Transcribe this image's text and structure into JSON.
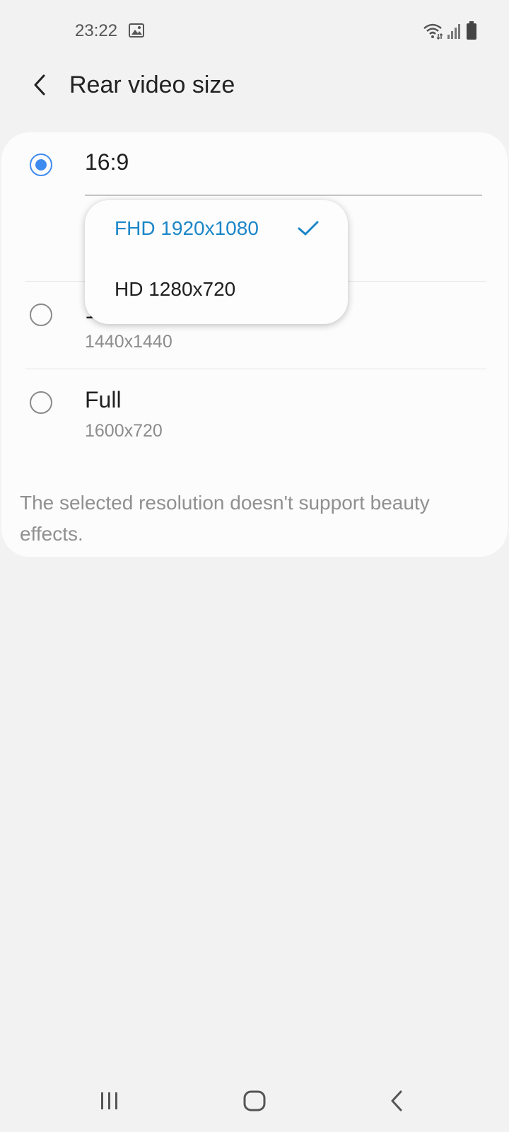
{
  "status_bar": {
    "time": "23:22",
    "icons": [
      "gallery-icon",
      "wifi-icon",
      "signal-icon",
      "battery-icon"
    ]
  },
  "header": {
    "title": "Rear video size",
    "back_icon": "back-arrow-icon"
  },
  "options": [
    {
      "label": "16:9",
      "sublabel": "",
      "selected": true
    },
    {
      "label": "1:1",
      "sublabel": "1440x1440",
      "selected": false
    },
    {
      "label": "Full",
      "sublabel": "1600x720",
      "selected": false
    }
  ],
  "dropdown": {
    "items": [
      {
        "label": "FHD 1920x1080",
        "selected": true
      },
      {
        "label": "HD 1280x720",
        "selected": false
      }
    ]
  },
  "notice": "The selected resolution doesn't support beauty effects.",
  "colors": {
    "accent": "#3e8bf0",
    "selected_text": "#1b86c8",
    "background": "#f2f2f2",
    "card": "#fcfcfc"
  },
  "nav_bar": {
    "icons": [
      "recent-apps-icon",
      "home-icon",
      "back-icon"
    ]
  }
}
